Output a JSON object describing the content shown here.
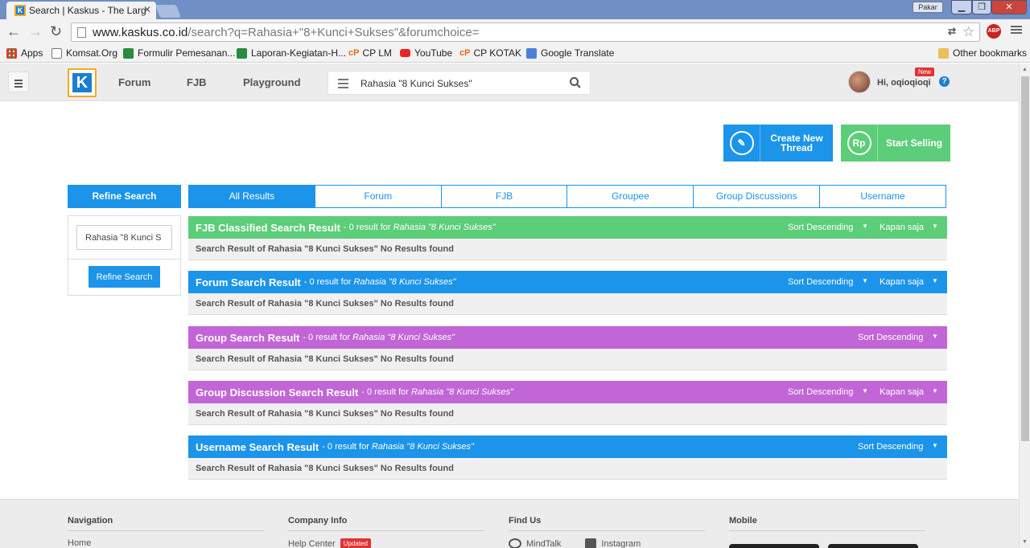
{
  "browser": {
    "tab_title": "Search | Kaskus - The Larg",
    "user_chip": "Pakar",
    "url_host": "www.kaskus.co.id",
    "url_rest": "/search?q=Rahasia+\"8+Kunci+Sukses\"&forumchoice=",
    "bookmarks": [
      "Apps",
      "Komsat.Org",
      "Formulir Pemesanan...",
      "Laporan-Kegiatan-H...",
      "CP LM",
      "YouTube",
      "CP KOTAK",
      "Google Translate"
    ],
    "other_bookmarks": "Other bookmarks"
  },
  "header": {
    "nav": [
      "Forum",
      "FJB",
      "Playground"
    ],
    "search_value": "Rahasia \"8 Kunci Sukses\"",
    "greeting": "Hi, oqioqioqi",
    "new_badge": "New"
  },
  "actions": {
    "create_thread": "Create New Thread",
    "start_selling": "Start Selling",
    "rp_symbol": "Rp"
  },
  "refine": {
    "title": "Refine Search",
    "input_value": "Rahasia \"8 Kunci S",
    "button": "Refine Search"
  },
  "tabs": [
    "All Results",
    "Forum",
    "FJB",
    "Groupee",
    "Group Discussions",
    "Username"
  ],
  "sections": [
    {
      "title": "FJB Classified Search Result",
      "count": "- 0 result for",
      "query": "Rahasia \"8 Kunci Sukses\"",
      "sort": "Sort Descending",
      "time": "Kapan saja",
      "color": "#5ccd78",
      "message": "Search Result of Rahasia \"8 Kunci Sukses\" No Results found"
    },
    {
      "title": "Forum Search Result",
      "count": "- 0 result for",
      "query": "Rahasia \"8 Kunci Sukses\"",
      "sort": "Sort Descending",
      "time": "Kapan saja",
      "color": "#1b94ea",
      "message": "Search Result of Rahasia \"8 Kunci Sukses\" No Results found"
    },
    {
      "title": "Group Search Result",
      "count": "- 0 result for",
      "query": "Rahasia \"8 Kunci Sukses\"",
      "sort": "Sort Descending",
      "time": "",
      "color": "#c265d6",
      "message": "Search Result of Rahasia \"8 Kunci Sukses\" No Results found"
    },
    {
      "title": "Group Discussion Search Result",
      "count": "- 0 result for",
      "query": "Rahasia \"8 Kunci Sukses\"",
      "sort": "Sort Descending",
      "time": "Kapan saja",
      "color": "#c265d6",
      "message": "Search Result of Rahasia \"8 Kunci Sukses\" No Results found"
    },
    {
      "title": "Username Search Result",
      "count": "- 0 result for",
      "query": "Rahasia \"8 Kunci Sukses\"",
      "sort": "Sort Descending",
      "time": "",
      "color": "#1b94ea",
      "message": "Search Result of Rahasia \"8 Kunci Sukses\" No Results found"
    }
  ],
  "footer": {
    "navigation": {
      "heading": "Navigation",
      "item": "Home"
    },
    "company": {
      "heading": "Company Info",
      "item": "Help Center",
      "badge": "Updated"
    },
    "find_us": {
      "heading": "Find Us",
      "items": [
        "MindTalk",
        "Instagram"
      ]
    },
    "mobile": {
      "heading": "Mobile"
    }
  },
  "colors": {
    "kaskus_blue": "#1b94ea",
    "green": "#5ccd78",
    "purple": "#c265d6",
    "logo_orange": "#f7a723"
  },
  "icons": [
    "pencil-icon",
    "search-icon",
    "hamburger-icon",
    "help-icon",
    "star-icon",
    "menu-icon"
  ]
}
